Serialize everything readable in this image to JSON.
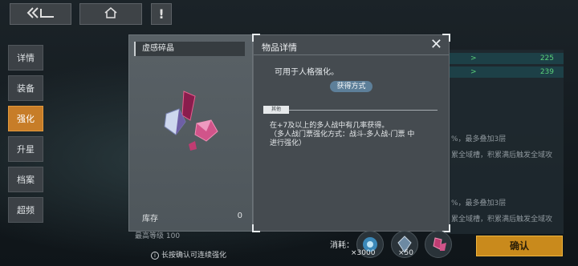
{
  "top": {
    "back_icon": "double-chevron-left-icon",
    "home_icon": "home-icon",
    "alert_label": "!"
  },
  "menu": [
    {
      "label": "详情",
      "active": false
    },
    {
      "label": "装备",
      "active": false
    },
    {
      "label": "强化",
      "active": true
    },
    {
      "label": "升星",
      "active": false
    },
    {
      "label": "档案",
      "active": false
    },
    {
      "label": "超频",
      "active": false
    }
  ],
  "item": {
    "name": "虚感碎晶",
    "stock_label": "库存",
    "stock_value": "0"
  },
  "detail": {
    "title": "物品详情",
    "description": "可用于人格强化。",
    "obtain_button": "获得方式",
    "other_tag": "其他",
    "other_lines": [
      "在+7及以上的多人战中有几率获得。",
      "（多人战门票强化方式：战斗-多人战-门票 中",
      "进行强化）"
    ]
  },
  "background_panel": {
    "stats": [
      {
        "arrow": ">",
        "value": "225"
      },
      {
        "arrow": ">",
        "value": "239"
      }
    ],
    "texts": [
      "%，最多叠加3层",
      "累全域槽，积累满后触发全域攻",
      "%，最多叠加3层",
      "累全域槽，积累满后触发全域攻"
    ]
  },
  "bottom": {
    "progress_label": "最高等级 100",
    "hint": "长按确认可连续强化",
    "cost_label": "消耗：",
    "costs": [
      {
        "count": "×3000"
      },
      {
        "count": "×50"
      },
      {
        "count": ""
      }
    ],
    "confirm": "确认"
  },
  "colors": {
    "accent": "#c77d28",
    "confirm": "#c98a1c",
    "stat_green": "#5ad17a"
  }
}
